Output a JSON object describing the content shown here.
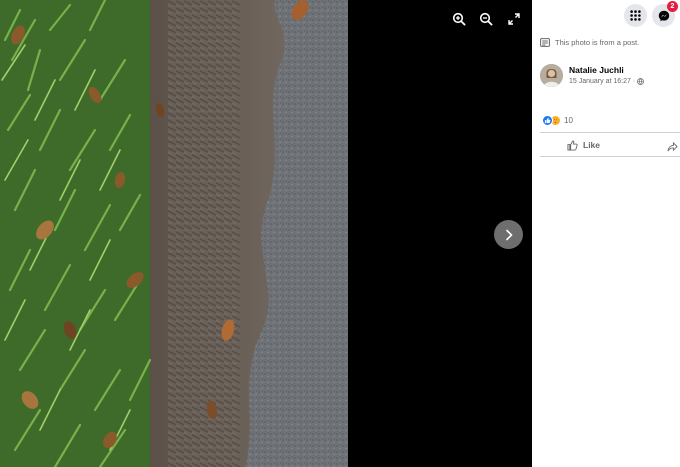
{
  "viewer": {
    "zoom_in_icon": "zoom-in-icon",
    "zoom_out_icon": "zoom-out-icon",
    "fullscreen_icon": "fullscreen-icon",
    "next_icon": "chevron-right-icon"
  },
  "panel": {
    "menu_icon": "grid-menu-icon",
    "messenger_icon": "messenger-icon",
    "messenger_badge": "2",
    "note_text": "This photo is from a post.",
    "author_name": "Natalie Juchli",
    "timestamp": "15 January at 16:27",
    "separator": "·",
    "reaction_count": "10",
    "like_label": "Like"
  },
  "colors": {
    "badge": "#e41e3f",
    "like_blue": "#1877f2",
    "care_yellow": "#f7b125"
  }
}
